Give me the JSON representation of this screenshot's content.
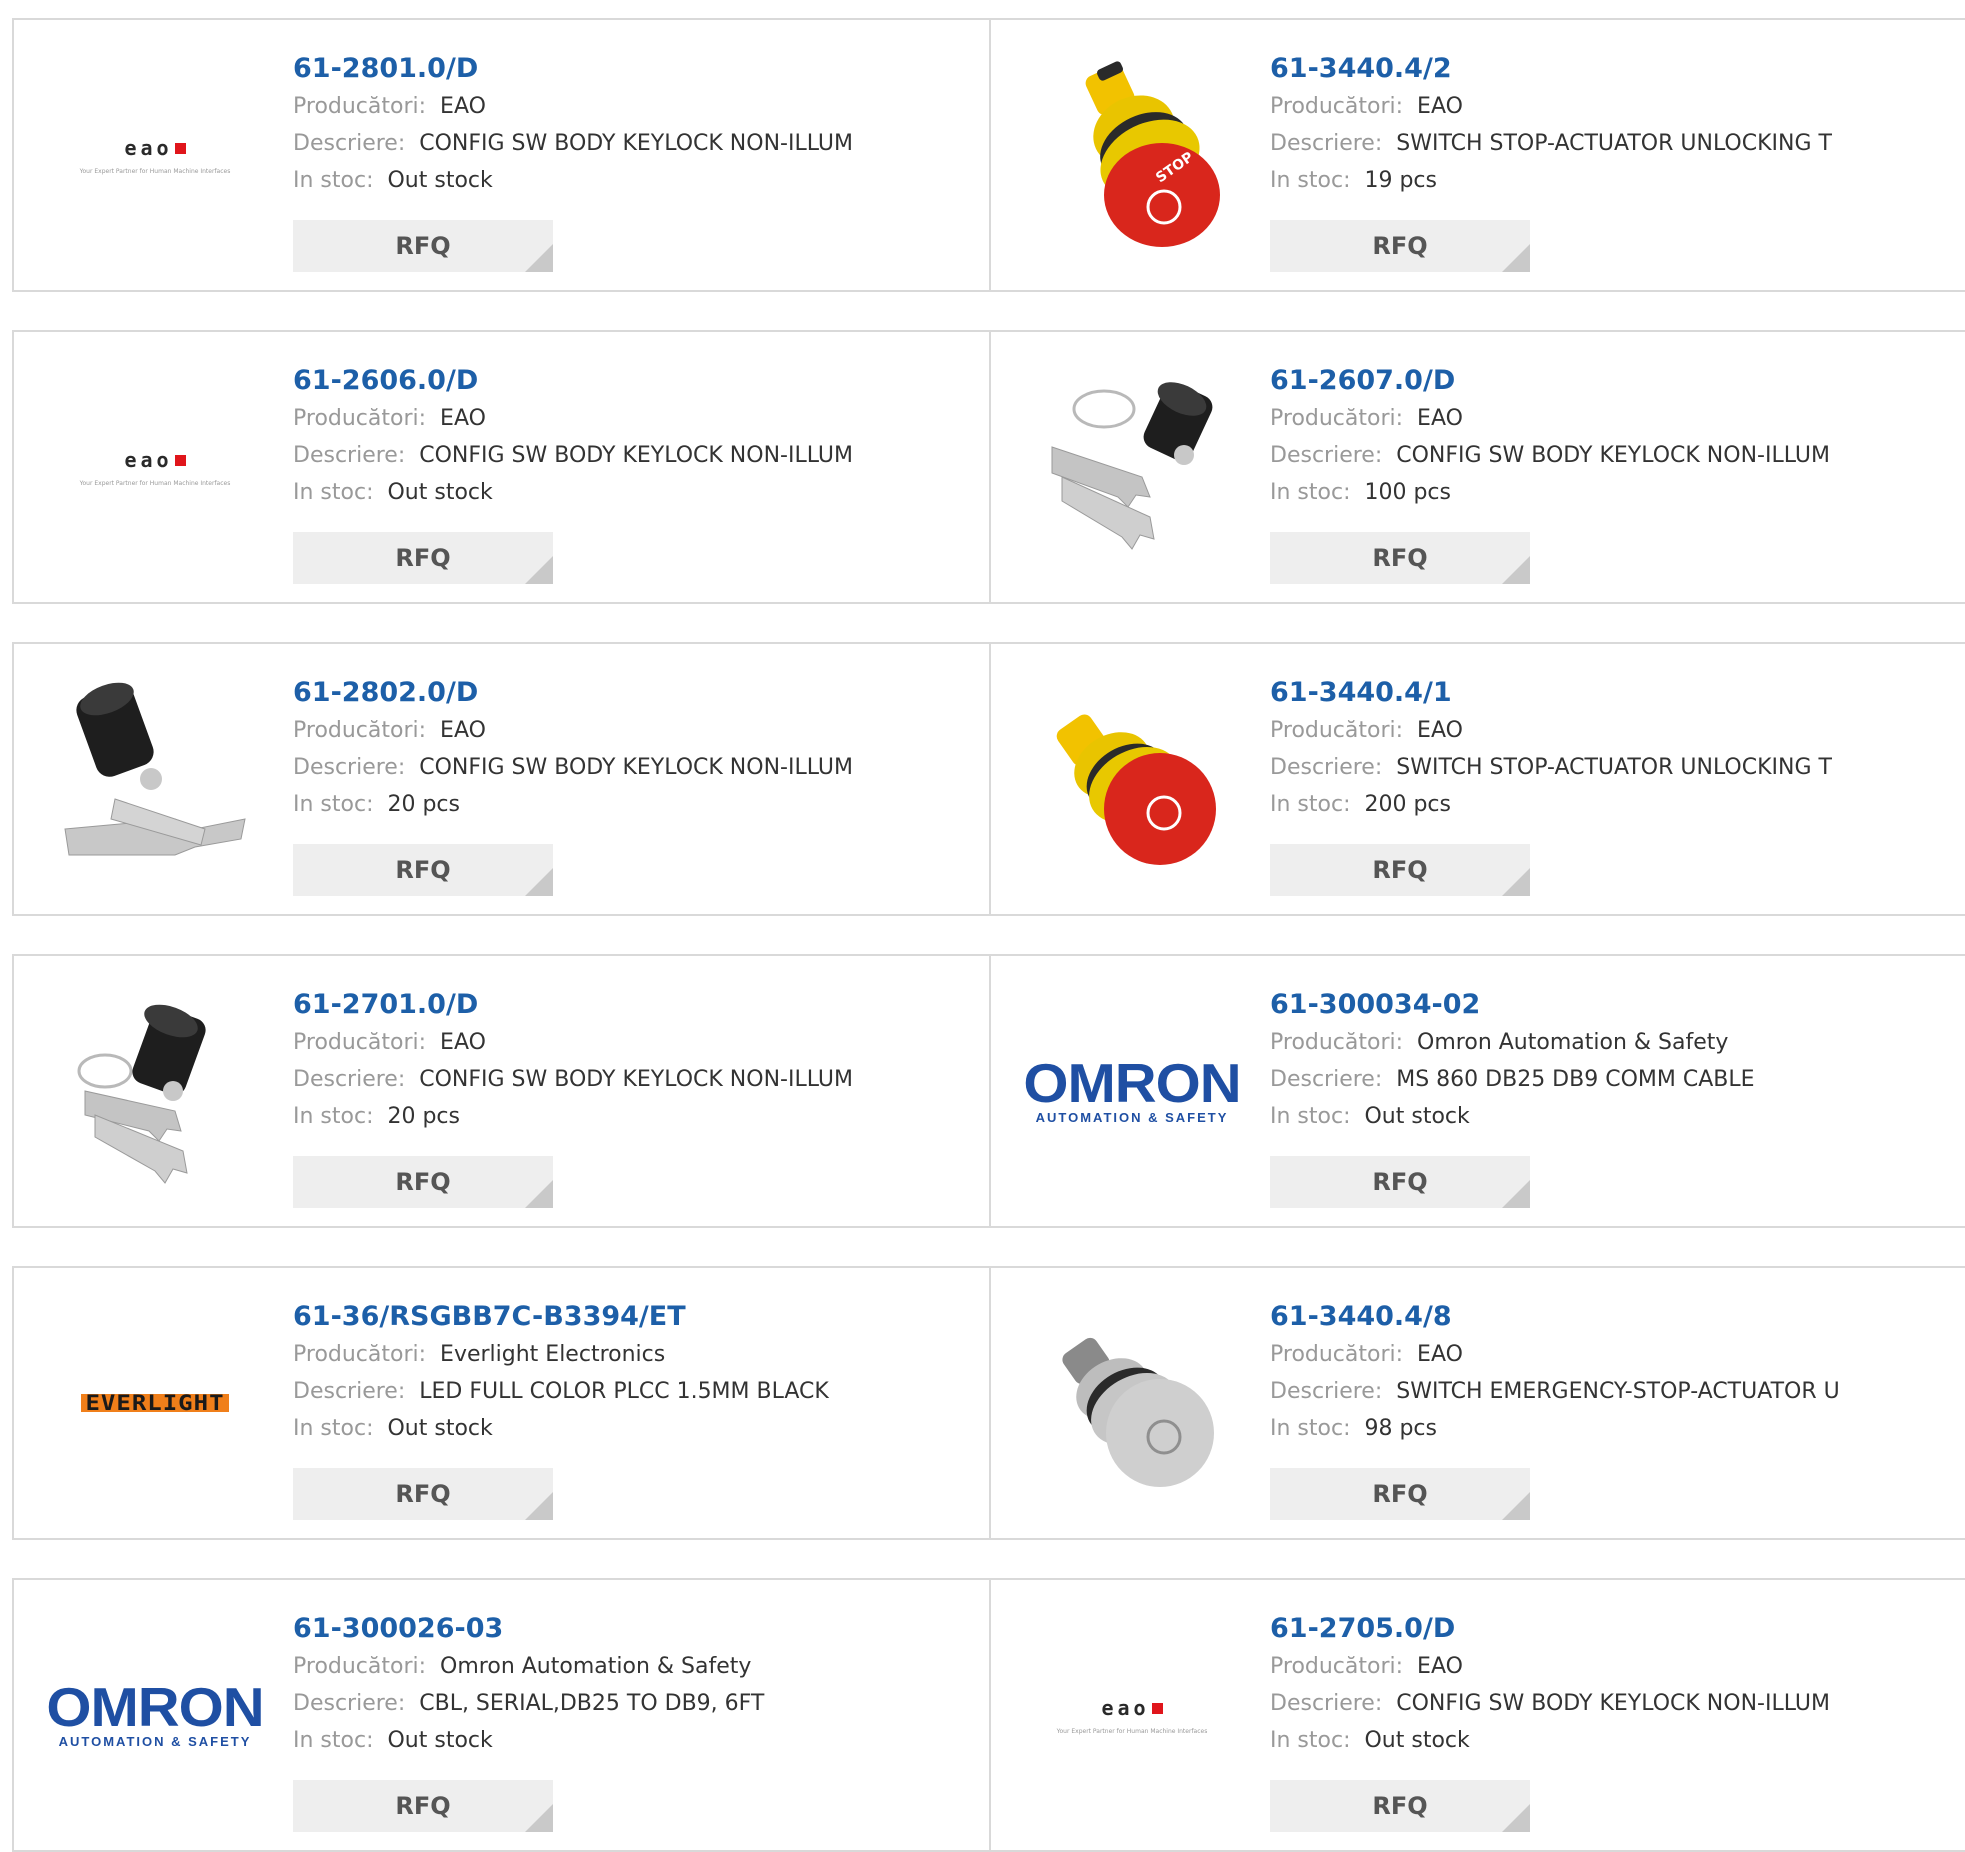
{
  "labels": {
    "manufacturer": "Producători:",
    "description": "Descriere:",
    "stock": "In stoc:",
    "rfq": "RFQ"
  },
  "products": [
    {
      "part": "61-2801.0/D",
      "manufacturer": "EAO",
      "description": "CONFIG SW BODY KEYLOCK NON-ILLUM",
      "stock": "Out stock",
      "image": "eao-logo",
      "logo_word": "eao",
      "logo_tagline": "Your Expert Partner for Human Machine Interfaces"
    },
    {
      "part": "61-3440.4/2",
      "manufacturer": "EAO",
      "description": "SWITCH STOP-ACTUATOR UNLOCKING T",
      "stock": "19 pcs",
      "image": "red-stop-button-photo",
      "stop_text": "STOP"
    },
    {
      "part": "61-2606.0/D",
      "manufacturer": "EAO",
      "description": "CONFIG SW BODY KEYLOCK NON-ILLUM",
      "stock": "Out stock",
      "image": "eao-logo",
      "logo_word": "eao",
      "logo_tagline": "Your Expert Partner for Human Machine Interfaces"
    },
    {
      "part": "61-2607.0/D",
      "manufacturer": "EAO",
      "description": "CONFIG SW BODY KEYLOCK NON-ILLUM",
      "stock": "100 pcs",
      "image": "keylock-with-keyring-photo"
    },
    {
      "part": "61-2802.0/D",
      "manufacturer": "EAO",
      "description": "CONFIG SW BODY KEYLOCK NON-ILLUM",
      "stock": "20 pcs",
      "image": "keylock-with-keys-photo"
    },
    {
      "part": "61-3440.4/1",
      "manufacturer": "EAO",
      "description": "SWITCH STOP-ACTUATOR UNLOCKING T",
      "stock": "200 pcs",
      "image": "red-stop-button-photo"
    },
    {
      "part": "61-2701.0/D",
      "manufacturer": "EAO",
      "description": "CONFIG SW BODY KEYLOCK NON-ILLUM",
      "stock": "20 pcs",
      "image": "keylock-with-keyring-photo"
    },
    {
      "part": "61-300034-02",
      "manufacturer": "Omron Automation & Safety",
      "description": "MS 860 DB25 DB9 COMM CABLE",
      "stock": "Out stock",
      "image": "omron-logo",
      "logo_word": "OMRON",
      "logo_tagline": "AUTOMATION & SAFETY"
    },
    {
      "part": "61-36/RSGBB7C-B3394/ET",
      "manufacturer": "Everlight Electronics",
      "description": "LED FULL COLOR PLCC 1.5MM BLACK",
      "stock": "Out stock",
      "image": "everlight-logo",
      "logo_word": "EVERLIGHT"
    },
    {
      "part": "61-3440.4/8",
      "manufacturer": "EAO",
      "description": "SWITCH EMERGENCY-STOP-ACTUATOR U",
      "stock": "98 pcs",
      "image": "grey-stop-button-photo"
    },
    {
      "part": "61-300026-03",
      "manufacturer": "Omron Automation & Safety",
      "description": "CBL, SERIAL,DB25 TO DB9, 6FT",
      "stock": "Out stock",
      "image": "omron-logo",
      "logo_word": "OMRON",
      "logo_tagline": "AUTOMATION & SAFETY"
    },
    {
      "part": "61-2705.0/D",
      "manufacturer": "EAO",
      "description": "CONFIG SW BODY KEYLOCK NON-ILLUM",
      "stock": "Out stock",
      "image": "eao-logo",
      "logo_word": "eao",
      "logo_tagline": "Your Expert Partner for Human Machine Interfaces"
    }
  ],
  "colors": {
    "link": "#1d5fa8",
    "label": "#999999",
    "value": "#333333",
    "button_bg": "#eeeeee",
    "border": "#d9d9d9"
  }
}
